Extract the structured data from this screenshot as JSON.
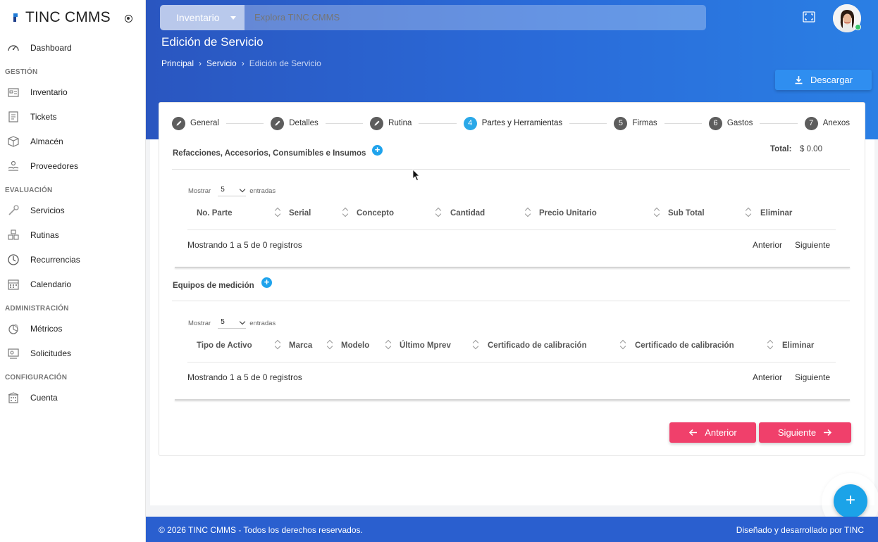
{
  "sidebar": {
    "brand": "TINC CMMS",
    "sections": {
      "gestion": "GESTIÓN",
      "evaluacion": "EVALUACIÓN",
      "administracion": "ADMINISTRACIÓN",
      "configuracion": "CONFIGURACIÓN"
    },
    "items": {
      "dashboard": "Dashboard",
      "inventario": "Inventario",
      "tickets": "Tickets",
      "almacen": "Almacén",
      "proveedores": "Proveedores",
      "servicios": "Servicios",
      "rutinas": "Rutinas",
      "recurrencias": "Recurrencias",
      "calendario": "Calendario",
      "metricos": "Métricos",
      "solicitudes": "Solicitudes",
      "cuenta": "Cuenta"
    }
  },
  "header": {
    "search_scope": "Inventario",
    "search_placeholder": "Explora TINC CMMS",
    "page_title": "Edición de Servicio",
    "breadcrumb": [
      "Principal",
      "Servicio",
      "Edición de Servicio"
    ],
    "breadcrumb_sep": "›",
    "download_label": "Descargar"
  },
  "stepper": {
    "steps": [
      {
        "num": "",
        "label": "General"
      },
      {
        "num": "",
        "label": "Detalles"
      },
      {
        "num": "",
        "label": "Rutina"
      },
      {
        "num": "4",
        "label": "Partes y Herramientas"
      },
      {
        "num": "5",
        "label": "Firmas"
      },
      {
        "num": "6",
        "label": "Gastos"
      },
      {
        "num": "7",
        "label": "Anexos"
      }
    ],
    "active_index": 3
  },
  "parts": {
    "title": "Refacciones, Accesorios, Consumibles e Insumos",
    "total_label": "Total:",
    "total_value": "$ 0.00",
    "show_label": "Mostrar",
    "show_value": "5",
    "entries_label": "entradas",
    "columns": [
      "No. Parte",
      "Serial",
      "Concepto",
      "Cantidad",
      "Precio Unitario",
      "Sub Total",
      "Eliminar"
    ],
    "info": "Mostrando 1 a 5 de 0 registros",
    "prev": "Anterior",
    "next": "Siguiente"
  },
  "equipment": {
    "title": "Equipos de medición",
    "show_label": "Mostrar",
    "show_value": "5",
    "entries_label": "entradas",
    "columns": [
      "Tipo de Activo",
      "Marca",
      "Modelo",
      "Último Mprev",
      "Certificado de calibración",
      "Certificado de calibración",
      "Eliminar"
    ],
    "info": "Mostrando 1 a 5 de 0 registros",
    "prev": "Anterior",
    "next": "Siguiente"
  },
  "wizard_nav": {
    "prev": "Anterior",
    "next": "Siguiente"
  },
  "footer": {
    "left": "© 2026 TINC CMMS - Todos los derechos reservados.",
    "right": "Diseñado y desarrollado por TINC"
  },
  "fab_label": "+",
  "colors": {
    "header_blue": "#2a6bd9",
    "accent_pink": "#f0406b",
    "accent_cyan": "#1fa3ec",
    "download_blue": "#2f8ef0",
    "footer_blue": "#2a5fcf"
  }
}
